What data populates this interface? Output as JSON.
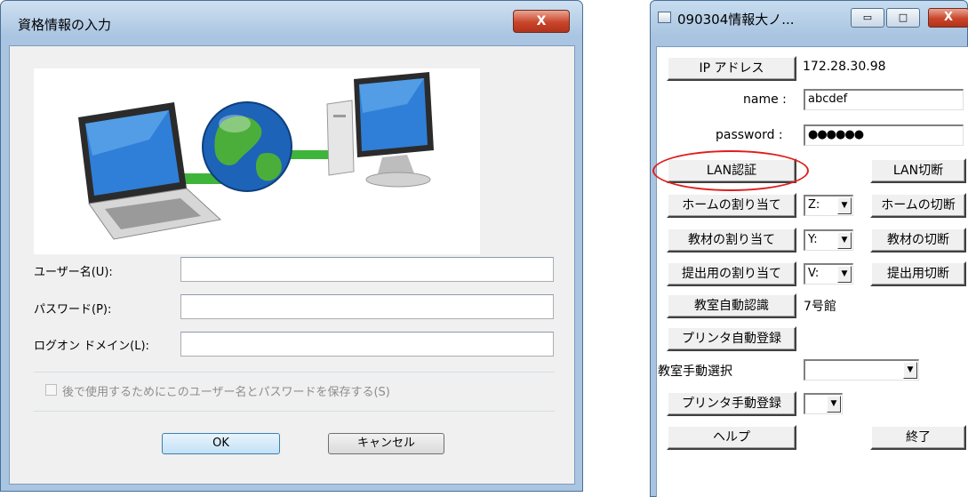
{
  "credentials_dialog": {
    "title": "資格情報の入力",
    "close_glyph": "X",
    "username_label": "ユーザー名(U):",
    "password_label": "パスワード(P):",
    "domain_label": "ログオン ドメイン(L):",
    "username_value": "",
    "password_value": "",
    "domain_value": "",
    "save_checkbox_label": "後で使用するためにこのユーザー名とパスワードを保存する(S)",
    "save_checked": false,
    "ok_label": "OK",
    "cancel_label": "キャンセル"
  },
  "app_window": {
    "title": "090304情報大ノ...",
    "minimize_glyph": "▭",
    "maximize_glyph": "□",
    "close_glyph": "X",
    "ip_button": "IP アドレス",
    "ip_value": "172.28.30.98",
    "name_label": "name :",
    "name_value": "abcdef",
    "password_label": "password :",
    "password_value": "●●●●●●",
    "lan_auth_button": "LAN認証",
    "lan_disconnect_button": "LAN切断",
    "home_assign_button": "ホームの割り当て",
    "home_drive": "Z:",
    "home_disconnect_button": "ホームの切断",
    "material_assign_button": "教材の割り当て",
    "material_drive": "Y:",
    "material_disconnect_button": "教材の切断",
    "submit_assign_button": "提出用の割り当て",
    "submit_drive": "V:",
    "submit_disconnect_button": "提出用切断",
    "room_auto_button": "教室自動認識",
    "room_value": "7号館",
    "printer_auto_button": "プリンタ自動登録",
    "room_manual_label": "教室手動選択",
    "room_manual_value": "",
    "printer_manual_button": "プリンタ手動登録",
    "printer_manual_value": "",
    "help_button": "ヘルプ",
    "exit_button": "終了",
    "dropdown_arrow": "▼"
  },
  "colors": {
    "highlight_ring": "#e01d1d",
    "glass_frame": "#a9c5e2",
    "close_red": "#c9452a"
  }
}
